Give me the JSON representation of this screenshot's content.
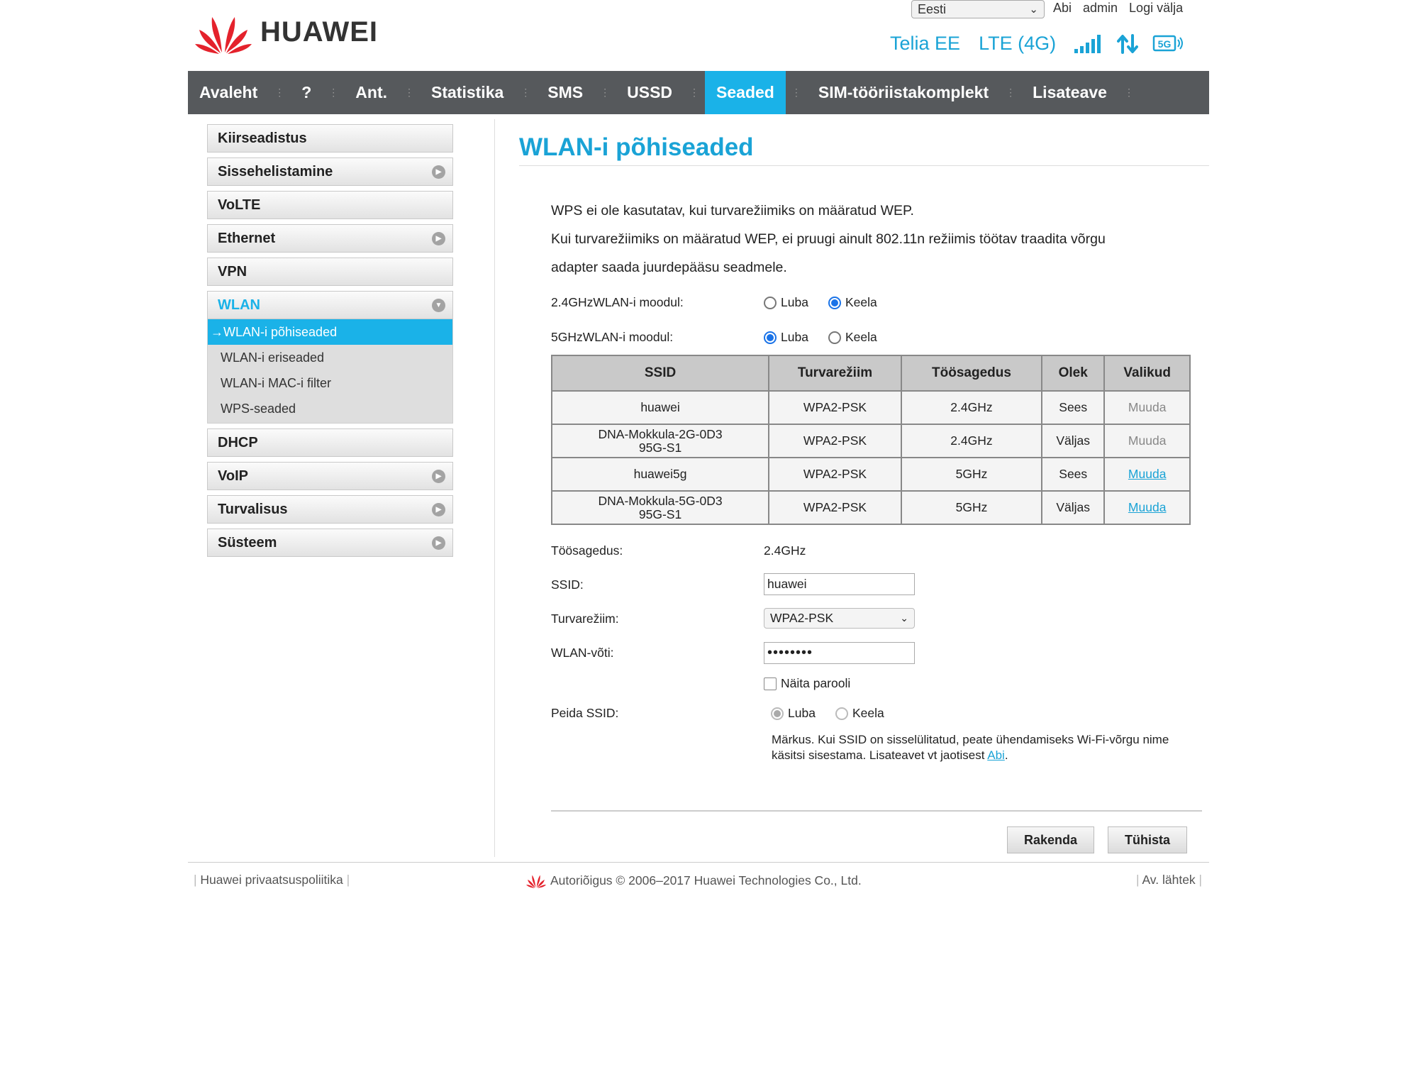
{
  "header": {
    "brand": "HUAWEI",
    "language": "Eesti",
    "links": [
      "Abi",
      "admin",
      "Logi välja"
    ],
    "operator": "Telia EE",
    "network": "LTE (4G)"
  },
  "nav": [
    "Avaleht",
    "?",
    "Ant.",
    "Statistika",
    "SMS",
    "USSD",
    "Seaded",
    "SIM-tööriistakomplekt",
    "Lisateave"
  ],
  "nav_active": "Seaded",
  "sidebar": {
    "items": [
      "Kiirseadistus",
      "Sissehelistamine",
      "VoLTE",
      "Ethernet",
      "VPN",
      "WLAN",
      "DHCP",
      "VoIP",
      "Turvalisus",
      "Süsteem"
    ],
    "wlan_sub": [
      "WLAN-i põhiseaded",
      "WLAN-i eriseaded",
      "WLAN-i MAC-i filter",
      "WPS-seaded"
    ],
    "active_sub_prefix": "→"
  },
  "main": {
    "title": "WLAN-i põhiseaded",
    "info_line1": "WPS ei ole kasutatav, kui turvarežiimiks on määratud WEP.",
    "info_line2": "Kui turvarežiimiks on määratud WEP, ei pruugi ainult 802.11n režiimis töötav traadita võrgu",
    "info_line3": "adapter saada juurdepääsu seadmele.",
    "module24_label": "2.4GHzWLAN-i moodul:",
    "module24_value": "Keela",
    "module5_label": "5GHzWLAN-i moodul:",
    "module5_value": "Luba",
    "luba": "Luba",
    "keela": "Keela",
    "table": {
      "headers": [
        "SSID",
        "Turvarežiim",
        "Töösagedus",
        "Olek",
        "Valikud"
      ],
      "rows": [
        {
          "ssid": "huawei",
          "ssid2": "",
          "mode": "WPA2-PSK",
          "freq": "2.4GHz",
          "state": "Sees",
          "action": "Muuda",
          "link": false
        },
        {
          "ssid": "DNA-Mokkula-2G-0D3",
          "ssid2": "95G-S1",
          "mode": "WPA2-PSK",
          "freq": "2.4GHz",
          "state": "Väljas",
          "action": "Muuda",
          "link": false
        },
        {
          "ssid": "huawei5g",
          "ssid2": "",
          "mode": "WPA2-PSK",
          "freq": "5GHz",
          "state": "Sees",
          "action": "Muuda",
          "link": true
        },
        {
          "ssid": "DNA-Mokkula-5G-0D3",
          "ssid2": "95G-S1",
          "mode": "WPA2-PSK",
          "freq": "5GHz",
          "state": "Väljas",
          "action": "Muuda",
          "link": true
        }
      ]
    },
    "freq_label": "Töösagedus:",
    "freq_value": "2.4GHz",
    "ssid_label": "SSID:",
    "ssid_value": "huawei",
    "security_label": "Turvarežiim:",
    "security_value": "WPA2-PSK",
    "key_label": "WLAN-võti:",
    "key_value": "••••••••",
    "show_password": "Näita parooli",
    "hide_ssid_label": "Peida SSID:",
    "hide_ssid_value": "Luba",
    "note_text": "Märkus. Kui SSID on sisselülitatud, peate ühendamiseks Wi-Fi-võrgu nime käsitsi sisestama. Lisateavet vt jaotisest ",
    "note_link": "Abi",
    "note_end": ".",
    "apply": "Rakenda",
    "cancel": "Tühista"
  },
  "footer": {
    "privacy": "Huawei privaatsuspoliitika",
    "copyright": "Autoriõigus © 2006–2017 Huawei Technologies Co., Ltd.",
    "opensource": "Av. lähtek"
  },
  "colors": {
    "accent": "#1ab2e8",
    "nav_bg": "#56595c",
    "title": "#1aa3d6",
    "logo_red": "#e4222c"
  },
  "icons": [
    "signal-bars-icon",
    "data-transfer-icon",
    "5g-icon",
    "chevron-down-icon",
    "arrow-right-icon"
  ]
}
